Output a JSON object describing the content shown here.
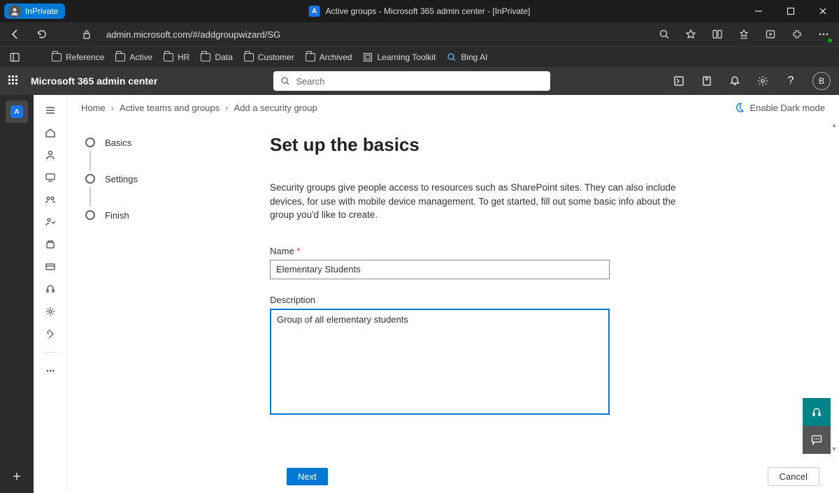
{
  "titlebar": {
    "inprivate": "InPrivate",
    "page_title": "Active groups - Microsoft 365 admin center - [InPrivate]"
  },
  "toolbar": {
    "url": "admin.microsoft.com/#/addgroupwizard/SG"
  },
  "bookmarks": [
    "Reference",
    "Active",
    "HR",
    "Data",
    "Customer",
    "Archived",
    "Learning Toolkit",
    "Bing AI"
  ],
  "admin_header": {
    "brand": "Microsoft 365 admin center",
    "search_placeholder": "Search",
    "avatar_initial": "B"
  },
  "breadcrumbs": {
    "items": [
      "Home",
      "Active teams and groups",
      "Add a security group"
    ],
    "dark_mode_label": "Enable Dark mode"
  },
  "steps": [
    "Basics",
    "Settings",
    "Finish"
  ],
  "form": {
    "heading": "Set up the basics",
    "description": "Security groups give people access to resources such as SharePoint sites. They can also include devices, for use with mobile device management. To get started, fill out some basic info about the group you'd like to create.",
    "name_label": "Name",
    "name_value": "Elementary Students",
    "desc_label": "Description",
    "desc_value": "Group of all elementary students"
  },
  "footer": {
    "next": "Next",
    "cancel": "Cancel"
  }
}
